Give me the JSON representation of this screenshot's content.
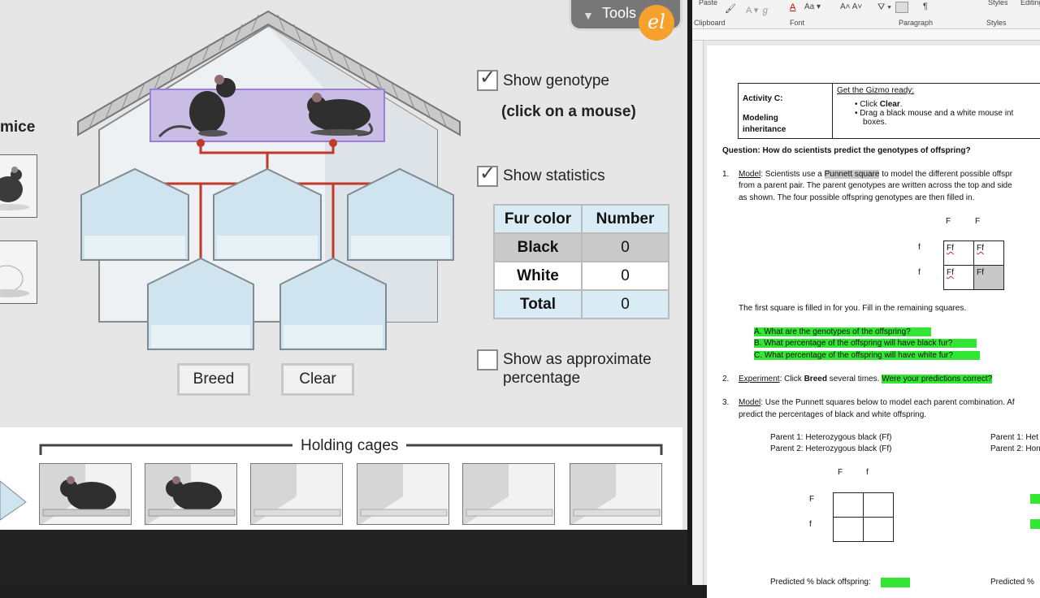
{
  "gizmo": {
    "tools_label": "Tools",
    "logo_text": "el",
    "mice_label": "mice",
    "show_genotype": {
      "label": "Show genotype",
      "checked": true
    },
    "click_hint": "(click on a mouse)",
    "show_statistics": {
      "label": "Show statistics",
      "checked": true
    },
    "show_percentage": {
      "label": "Show as approximate percentage",
      "checked": false
    },
    "stats": {
      "headers": [
        "Fur color",
        "Number"
      ],
      "rows": [
        {
          "label": "Black",
          "value": "0"
        },
        {
          "label": "White",
          "value": "0"
        },
        {
          "label": "Total",
          "value": "0"
        }
      ]
    },
    "breed_label": "Breed",
    "clear_label": "Clear",
    "holding_title": "Holding cages",
    "colors": {
      "line": "#c0392b",
      "cage_glass": "#cfe4ee",
      "highlight": "#9a7fd6"
    }
  },
  "word": {
    "ribbon": {
      "paste": "Paste",
      "clipboard": "Clipboard",
      "font": "Font",
      "paragraph": "Paragraph",
      "styles": "Styles",
      "styles_top": "Styles",
      "editing": "Editing"
    },
    "activity_label": "Activity C:",
    "activity_sub": "Modeling inheritance",
    "gizmo_ready": "Get the Gizmo ready:",
    "bullet1_pre": "Click ",
    "bullet1_bold": "Clear",
    "bullet1_post": ".",
    "bullet2": "Drag a black mouse and a white mouse int",
    "bullet2_cont": "boxes.",
    "question": "Question: How do scientists predict the genotypes of offspring?",
    "item1_num": "1.",
    "item1_model": "Model",
    "item1_text_a": ": Scientists use a ",
    "item1_term": "Punnett square",
    "item1_text_b": " to model the different possible offspr",
    "item1_line2": "from a parent pair. The parent genotypes are written across the top and side",
    "item1_line3": "as shown. The four possible offspring genotypes are then filled in.",
    "punnett1": {
      "top": [
        "F",
        "F"
      ],
      "side": [
        "f",
        "f"
      ],
      "cells": [
        "Ff",
        "Ff",
        "Ff",
        "Ff"
      ]
    },
    "filled_note": "The first square is filled in for you. Fill in the remaining squares.",
    "q_a": "A.   What are the genotypes of the offspring?",
    "q_b": "B.   What percentage of the offspring will have black fur?",
    "q_c": "C.   What percentage of the offspring will have white fur?",
    "item2_num": "2.",
    "item2_exp": "Experiment",
    "item2_text_a": ": Click ",
    "item2_bold": "Breed",
    "item2_text_b": " several times. ",
    "item2_hl": "Were your predictions correct?",
    "item3_num": "3.",
    "item3_model": "Model",
    "item3_text": ": Use the Punnett squares below to model each parent combination. Af",
    "item3_line2": "predict the percentages of black and white offspring.",
    "parent1a": "Parent 1: Heterozygous black (Ff)",
    "parent2a": "Parent 2: Heterozygous black (Ff)",
    "parent1b": "Parent 1: Het",
    "parent2b": "Parent 2: Hon",
    "punnett2": {
      "top": [
        "F",
        "f"
      ],
      "side": [
        "F",
        "f"
      ]
    },
    "predicted": "Predicted % black offspring:",
    "predicted_b": "Predicted %"
  }
}
